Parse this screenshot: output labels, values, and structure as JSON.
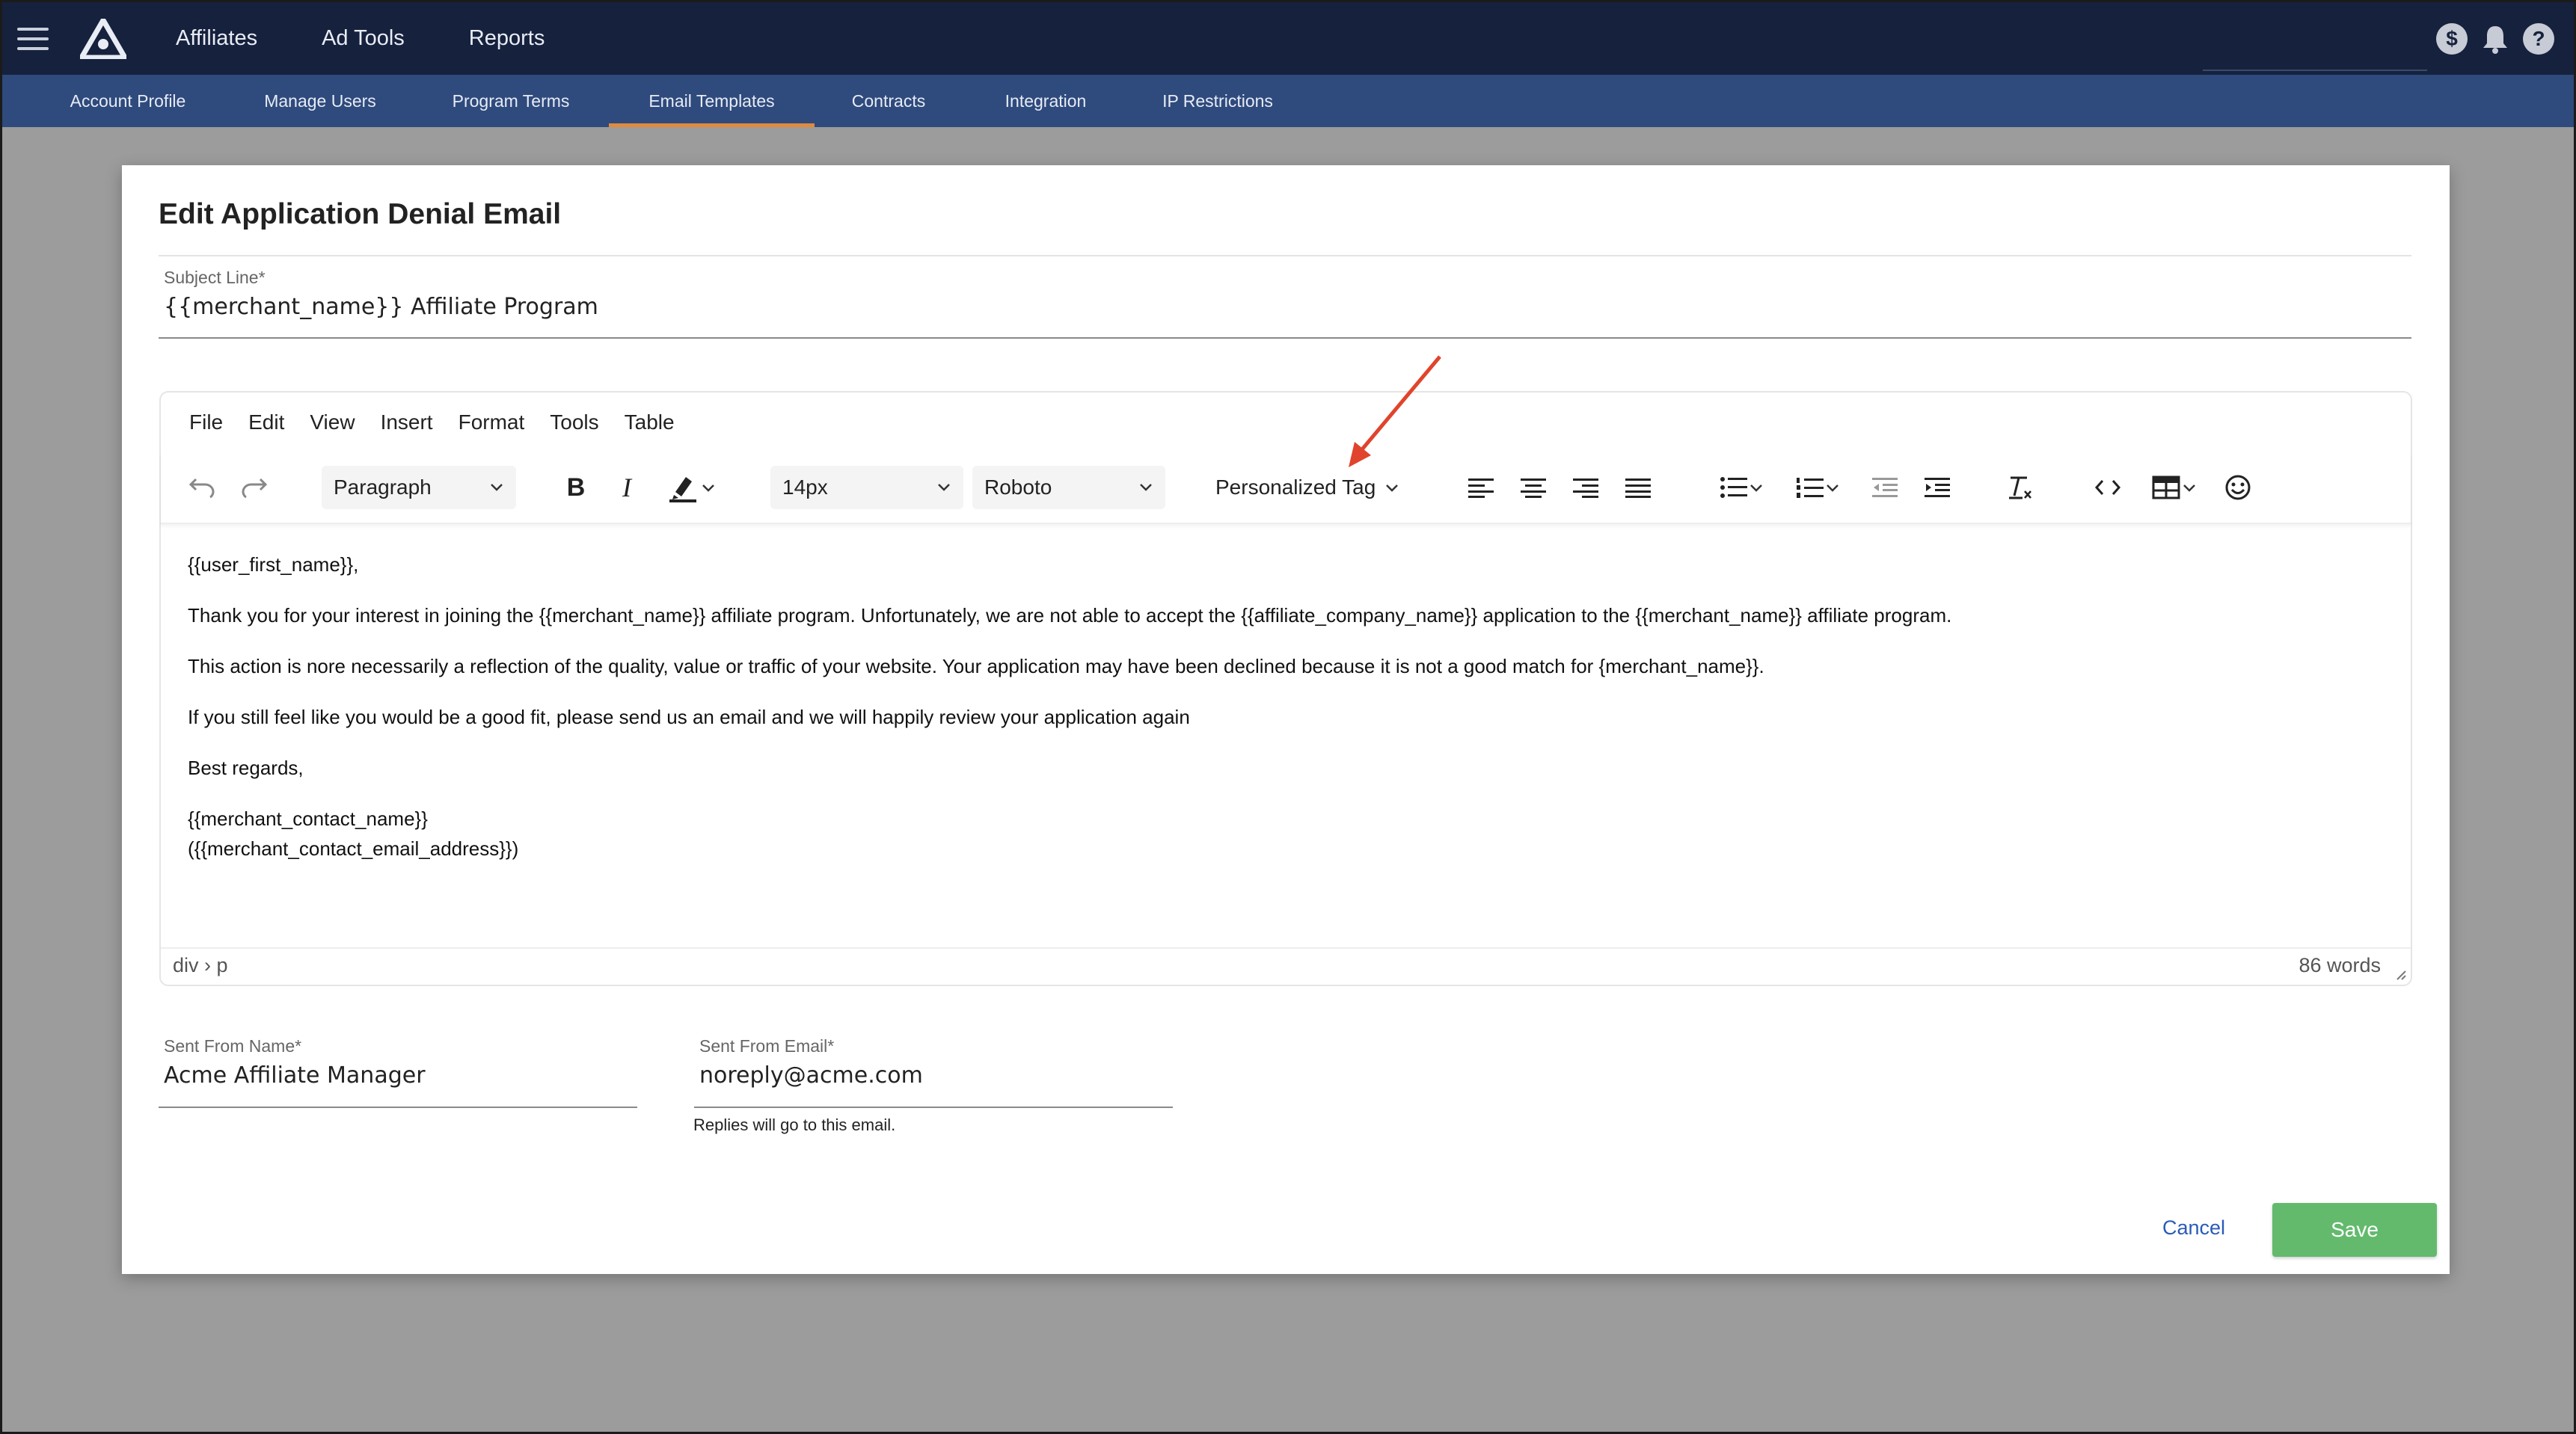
{
  "topnav": {
    "items": [
      "Affiliates",
      "Ad Tools",
      "Reports"
    ]
  },
  "topicons": [
    "dollar-icon",
    "bell-icon",
    "help-icon"
  ],
  "subnav": {
    "items": [
      "Account Profile",
      "Manage Users",
      "Program Terms",
      "Email Templates",
      "Contracts",
      "Integration",
      "IP Restrictions"
    ],
    "active": "Email Templates",
    "accent": "#e28a3c"
  },
  "modal": {
    "title": "Edit Application Denial Email",
    "subject": {
      "label": "Subject Line*",
      "value": "{{merchant_name}} Affiliate Program"
    },
    "editor": {
      "menu": [
        "File",
        "Edit",
        "View",
        "Insert",
        "Format",
        "Tools",
        "Table"
      ],
      "block_format": "Paragraph",
      "font_size": "14px",
      "font_family": "Roboto",
      "personalized_tag": "Personalized Tag",
      "content": [
        "{{user_first_name}},",
        "Thank you for your interest in joining the {{merchant_name}} affiliate program.  Unfortunately, we are not able to accept the {{affiliate_company_name}} application to the {{merchant_name}} affiliate program.",
        "This action is nore necessarily a reflection of the quality, value or traffic of your website.  Your application may have been declined because it is not a good match for {merchant_name}}.",
        "If you still feel like you would be a good fit, please send us an email and we will happily review your application again",
        "Best regards,",
        "{{merchant_contact_name}}",
        "({{merchant_contact_email_address}})"
      ],
      "path": "div › p",
      "word_count": "86 words"
    },
    "sent_from_name": {
      "label": "Sent From Name*",
      "value": "Acme Affiliate Manager"
    },
    "sent_from_email": {
      "label": "Sent From Email*",
      "value": "noreply@acme.com",
      "helper": "Replies will go to this email."
    },
    "cancel_label": "Cancel",
    "save_label": "Save",
    "save_color": "#63ba6d"
  },
  "annotation_arrow_color": "#e0442c"
}
